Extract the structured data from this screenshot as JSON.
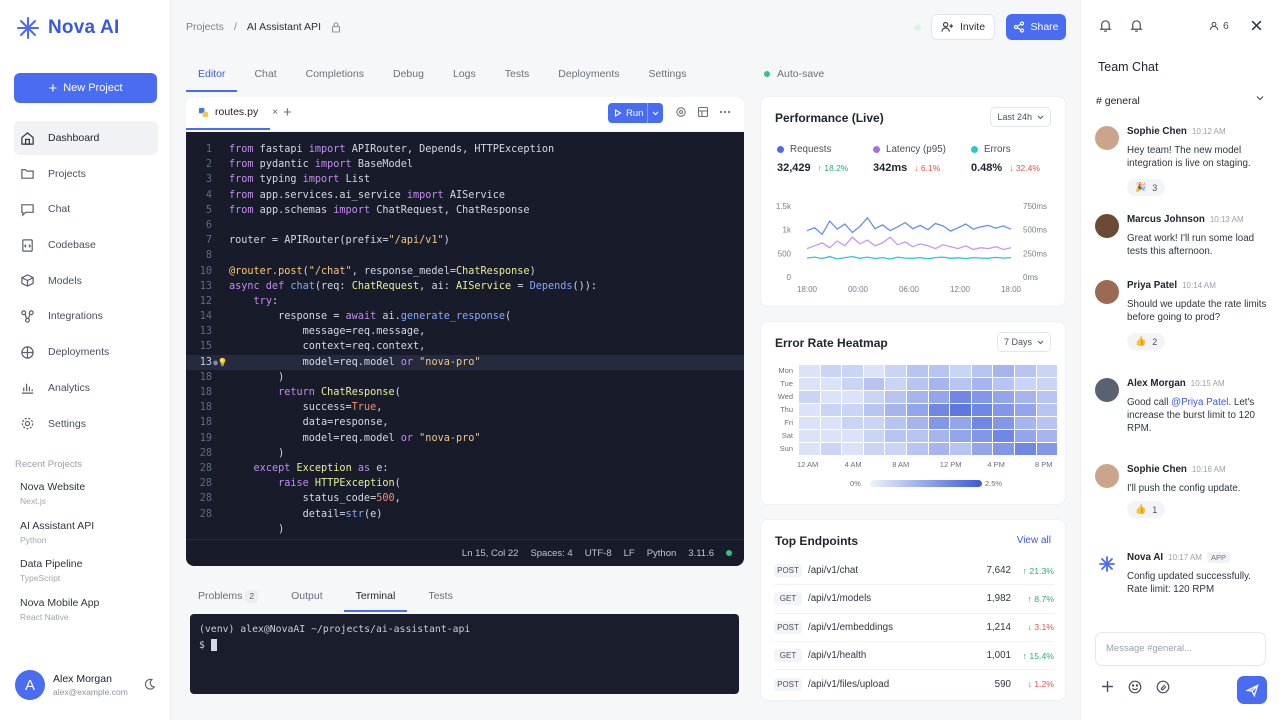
{
  "brand": {
    "name": "Nova AI"
  },
  "sidebar": {
    "new_project": "New Project",
    "items": [
      {
        "label": "Dashboard",
        "icon": "home-icon",
        "active": true
      },
      {
        "label": "Projects",
        "icon": "folder-icon"
      },
      {
        "label": "Chat",
        "icon": "chat-icon"
      },
      {
        "label": "Codebase",
        "icon": "file-code-icon"
      },
      {
        "label": "Models",
        "icon": "cube-icon"
      },
      {
        "label": "Integrations",
        "icon": "plug-icon"
      },
      {
        "label": "Deployments",
        "icon": "rocket-icon"
      },
      {
        "label": "Analytics",
        "icon": "bar-chart-icon"
      },
      {
        "label": "Settings",
        "icon": "gear-icon"
      }
    ],
    "recent_title": "Recent Projects",
    "recent": [
      {
        "name": "Nova Website",
        "stack": "Next.js"
      },
      {
        "name": "AI Assistant API",
        "stack": "Python"
      },
      {
        "name": "Data Pipeline",
        "stack": "TypeScript"
      },
      {
        "name": "Nova Mobile App",
        "stack": "React Native"
      }
    ],
    "user": {
      "initial": "A",
      "name": "Alex Morgan",
      "email": "alex@example.com"
    }
  },
  "topbar": {
    "crumb_root": "Projects",
    "crumb_sep": "/",
    "crumb_current": "AI Assistant API",
    "invite": "Invite",
    "share": "Share"
  },
  "tabs": [
    "Editor",
    "Chat",
    "Completions",
    "Debug",
    "Logs",
    "Tests",
    "Deployments",
    "Settings"
  ],
  "autosave": "Auto-save",
  "editor": {
    "file": "routes.py",
    "close": "×",
    "add": "+",
    "run": "Run",
    "status": {
      "pos": "Ln 15, Col 22",
      "spaces": "Spaces: 4",
      "enc": "UTF-8",
      "eol": "LF",
      "lang": "Python",
      "ver": "3.11.6"
    },
    "line_numbers": [
      "1",
      "2",
      "3",
      "4",
      "5",
      "6",
      "7",
      "8",
      "10",
      "13",
      "12",
      "14",
      "13",
      "15",
      "13",
      "18",
      "18",
      "18",
      "18",
      "19",
      "28",
      "28",
      "28",
      "28",
      "28"
    ]
  },
  "panel_tabs": {
    "problems": "Problems",
    "problems_count": "2",
    "output": "Output",
    "terminal": "Terminal",
    "tests": "Tests"
  },
  "terminal": {
    "line1": "(venv) alex@NovaAI ~/projects/ai-assistant-api",
    "prompt": "$"
  },
  "performance": {
    "title": "Performance (Live)",
    "range": "Last 24h",
    "metrics": [
      {
        "label": "Requests",
        "value": "32,429",
        "delta": "↑ 18.2%",
        "color": "#4a6cf0",
        "dir": "up"
      },
      {
        "label": "Latency (p95)",
        "value": "342ms",
        "delta": "↓ 6.1%",
        "color": "#b069e6",
        "dir": "down"
      },
      {
        "label": "Errors",
        "value": "0.48%",
        "delta": "↓ 32.4%",
        "color": "#2cc6d4",
        "dir": "down"
      }
    ]
  },
  "chart_data": {
    "type": "line",
    "x": [
      "18:00",
      "00:00",
      "06:00",
      "12:00",
      "18:00"
    ],
    "y_left_ticks": [
      "0",
      "500",
      "1k",
      "1.5k"
    ],
    "y_right_ticks": [
      "0ms",
      "250ms",
      "500ms",
      "750ms"
    ],
    "ylim": [
      0,
      1500
    ],
    "y2lim": [
      0,
      750
    ],
    "series": [
      {
        "color": "#6a8af4",
        "axis": "left",
        "values": [
          980,
          1040,
          900,
          1180,
          1010,
          1120,
          940,
          1070,
          1250,
          1020,
          1100,
          980,
          1060,
          1150,
          1020,
          1090,
          1000,
          1130,
          1080,
          970,
          1040,
          1120,
          1010,
          1060,
          1090,
          1030,
          1080,
          1010
        ]
      },
      {
        "color": "#c29af0",
        "axis": "right",
        "values": [
          300,
          330,
          360,
          310,
          380,
          330,
          420,
          350,
          390,
          330,
          360,
          420,
          340,
          370,
          320,
          350,
          330,
          300,
          340,
          320,
          300,
          330,
          290,
          310,
          300,
          320,
          290,
          310
        ]
      },
      {
        "color": "#2cc6d4",
        "axis": "left",
        "values": [
          400,
          420,
          390,
          430,
          380,
          410,
          430,
          395,
          420,
          390,
          410,
          380,
          420,
          400,
          395,
          410,
          385,
          410,
          420,
          395,
          405,
          390,
          410,
          400,
          395,
          415,
          400,
          410
        ]
      }
    ]
  },
  "heatmap": {
    "title": "Error Rate Heatmap",
    "range": "7 Days",
    "days": [
      "Mon",
      "Tue",
      "Wed",
      "Thu",
      "Fri",
      "Sat",
      "Sun"
    ],
    "hours": [
      "12 AM",
      "4 AM",
      "8 AM",
      "12 PM",
      "4 PM",
      "8 PM"
    ],
    "legend_low": "0%",
    "legend_high": "2.5%",
    "values": [
      [
        0.1,
        0.2,
        0.2,
        0.1,
        0.2,
        0.3,
        0.3,
        0.2,
        0.3,
        0.4,
        0.3,
        0.2
      ],
      [
        0.1,
        0.1,
        0.2,
        0.3,
        0.2,
        0.3,
        0.4,
        0.3,
        0.4,
        0.3,
        0.2,
        0.2
      ],
      [
        0.2,
        0.1,
        0.1,
        0.2,
        0.3,
        0.4,
        0.5,
        0.7,
        0.6,
        0.5,
        0.4,
        0.3
      ],
      [
        0.1,
        0.2,
        0.2,
        0.3,
        0.4,
        0.5,
        0.7,
        0.8,
        0.7,
        0.6,
        0.5,
        0.3
      ],
      [
        0.1,
        0.1,
        0.2,
        0.2,
        0.3,
        0.4,
        0.6,
        0.5,
        0.7,
        0.6,
        0.4,
        0.3
      ],
      [
        0.1,
        0.1,
        0.1,
        0.2,
        0.3,
        0.3,
        0.4,
        0.5,
        0.6,
        0.7,
        0.5,
        0.4
      ],
      [
        0.1,
        0.2,
        0.1,
        0.2,
        0.2,
        0.3,
        0.4,
        0.3,
        0.5,
        0.6,
        0.7,
        0.6
      ]
    ]
  },
  "endpoints": {
    "title": "Top Endpoints",
    "view_all": "View all",
    "rows": [
      {
        "method": "POST",
        "path": "/api/v1/chat",
        "count": "7,642",
        "change": "↑ 21.3%",
        "dir": "up"
      },
      {
        "method": "GET",
        "path": "/api/v1/models",
        "count": "1,982",
        "change": "↑ 8.7%",
        "dir": "up"
      },
      {
        "method": "POST",
        "path": "/api/v1/embeddings",
        "count": "1,214",
        "change": "↓ 3.1%",
        "dir": "down"
      },
      {
        "method": "GET",
        "path": "/api/v1/health",
        "count": "1,001",
        "change": "↑ 15.4%",
        "dir": "up"
      },
      {
        "method": "POST",
        "path": "/api/v1/files/upload",
        "count": "590",
        "change": "↓ 1.2%",
        "dir": "down"
      }
    ]
  },
  "chat": {
    "members": "6",
    "title": "Team Chat",
    "channel": "# general",
    "input_placeholder": "Message #general...",
    "messages": [
      {
        "name": "Sophie Chen",
        "time": "10:12 AM",
        "text": "Hey team! The new model integration is live on staging.",
        "reaction": "🎉",
        "count": "3",
        "avatar": "#caa58c"
      },
      {
        "name": "Marcus Johnson",
        "time": "10:13 AM",
        "text": "Great work! I'll run some load tests this afternoon.",
        "avatar": "#6b4a36"
      },
      {
        "name": "Priya Patel",
        "time": "10:14 AM",
        "text": "Should we update the rate limits before going to prod?",
        "reaction": "👍",
        "count": "2",
        "avatar": "#9a6a52"
      },
      {
        "name": "Alex Morgan",
        "time": "10:15 AM",
        "text_pre": "Good call ",
        "mention": "@Priya Patel",
        "text_post": ". Let's increase the burst limit to 120 RPM.",
        "avatar": "#5a6272"
      },
      {
        "name": "Sophie Chen",
        "time": "10:16 AM",
        "text": "I'll push the config update.",
        "reaction": "👍",
        "count": "1",
        "avatar": "#caa58c"
      },
      {
        "name": "Nova AI",
        "time": "10:17 AM",
        "badge": "APP",
        "text": "Config updated successfully. Rate limit: 120 RPM"
      }
    ]
  }
}
